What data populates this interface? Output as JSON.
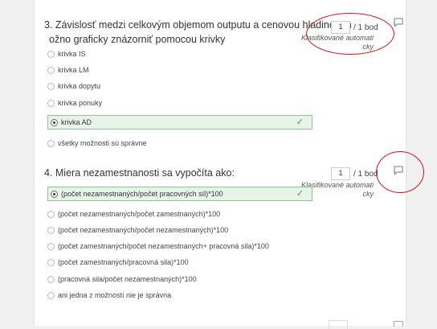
{
  "q3": {
    "title_line1": "3. Závislosť medzi celkovým objemom outputu a cenovou hladinou m",
    "title_line2": "ožno graficky znázorniť pomocou krivky",
    "score_value": "1",
    "score_label": "/ 1 bod",
    "auto_line1": "Klasifikované automati",
    "auto_line2": "cky",
    "options": [
      "krivka IS",
      "krivka LM",
      "krivka dopytu",
      "krivka ponuky",
      "krivka AD",
      "všetky možnosti sú správne"
    ],
    "checkmark": "✓"
  },
  "q4": {
    "title": "4. Miera nezamestnanosti sa vypočíta ako:",
    "score_value": "1",
    "score_label": "/ 1 bod",
    "auto_line1": "Klasifikované automati",
    "auto_line2": "cky",
    "options": [
      "(počet nezamestnaných/počet pracovných síl)*100",
      "(počet nezamestnaných/počet zamestnaných)*100",
      "(počet nezamestnaných/počet nezamestnaných)*100",
      "(počet zamestnaných/počet nezamestnaných+ pracovná sila)*100",
      "(počet zamestnaných/pracovná sila)*100",
      "(pracovná sila/počet nezamestnaných)*100",
      "ani jedna z možností nie je správna"
    ],
    "checkmark": "✓"
  },
  "colors": {
    "correct_bg": "#e8f4e8",
    "correct_border": "#8fc58f",
    "annotation_ring": "#dd1111"
  },
  "icons": {
    "comment": "comment-icon"
  }
}
